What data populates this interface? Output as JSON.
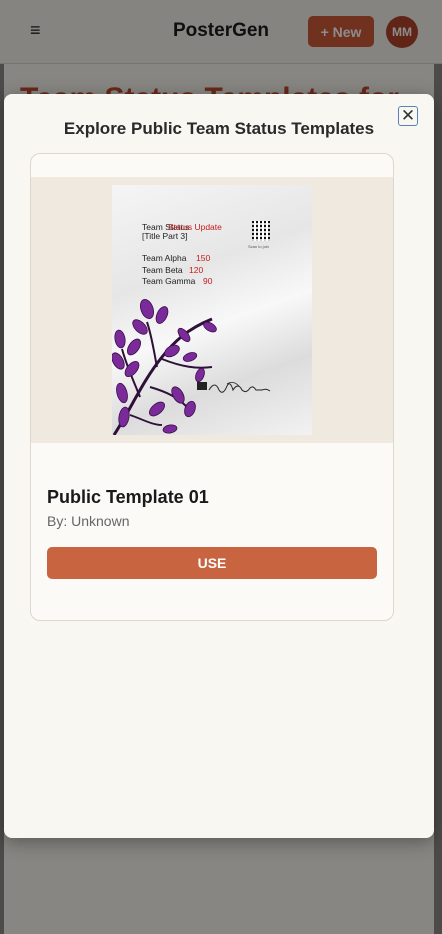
{
  "header": {
    "menu_glyph": "≡",
    "app_title": "PosterGen",
    "new_button_label": "+ New",
    "avatar_initials": "MM"
  },
  "background": {
    "page_heading": "Team Status Templates for"
  },
  "modal": {
    "title": "Explore Public Team Status Templates",
    "close_glyph": "✕",
    "templates": [
      {
        "name": "Public Template 01",
        "author": "By: Unknown",
        "use_label": "USE",
        "preview": {
          "title_overlap_a": "Team Status",
          "title_overlap_b": "Status Update",
          "title_part_3": "[Title Part 3]",
          "rows": [
            {
              "team": "Team Alpha",
              "value": "150"
            },
            {
              "team": "Team Beta",
              "value": "120"
            },
            {
              "team": "Team Gamma",
              "value": "90"
            }
          ],
          "qr_caption": "Scan to join"
        }
      }
    ]
  },
  "colors": {
    "accent": "#cc5a3a",
    "avatar": "#b0442a",
    "use_button": "#c8643f",
    "overlay": "#000000",
    "preview_values": "#c31c1c",
    "plant_leaves": "#7b2a9a"
  },
  "icons": {
    "menu": "hamburger-icon",
    "close": "close-icon"
  }
}
